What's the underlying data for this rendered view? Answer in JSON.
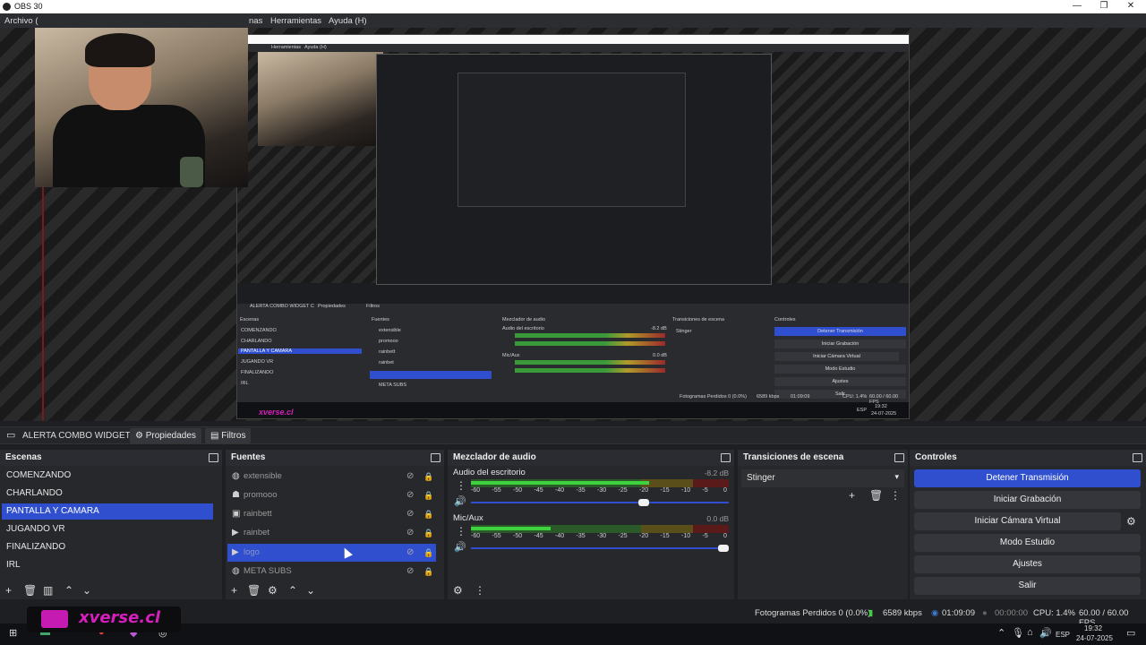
{
  "window": {
    "title": "OBS 30",
    "controls": [
      "—",
      "❐",
      "✕"
    ]
  },
  "menu": [
    "Archivo (",
    "nas",
    "Herramientas",
    "Ayuda (H)"
  ],
  "source_bar": {
    "current_source": "ALERTA COMBO WIDGET C",
    "properties": "Propiedades",
    "filters": "Filtros"
  },
  "scenes": {
    "title": "Escenas",
    "items": [
      "COMENZANDO",
      "CHARLANDO",
      "PANTALLA Y CAMARA",
      "JUGANDO VR",
      "FINALIZANDO",
      "IRL"
    ],
    "selected_index": 2
  },
  "sources": {
    "title": "Fuentes",
    "items": [
      {
        "name": "extensible",
        "icon": "globe-icon"
      },
      {
        "name": "promooo",
        "icon": "group-icon"
      },
      {
        "name": "rainbett",
        "icon": "image-icon"
      },
      {
        "name": "rainbet",
        "icon": "play-icon"
      },
      {
        "name": "logo",
        "icon": "play-icon"
      },
      {
        "name": "META SUBS",
        "icon": "globe-icon"
      }
    ],
    "selected_index": 4
  },
  "mixer": {
    "title": "Mezclador de audio",
    "channels": [
      {
        "name": "Audio del escritorio",
        "db": "-8.2 dB",
        "level": 0.69,
        "volume": 0.69
      },
      {
        "name": "Mic/Aux",
        "db": "0.0 dB",
        "level": 0.31,
        "volume": 1.0
      }
    ],
    "scale": [
      "-60",
      "-55",
      "-50",
      "-45",
      "-40",
      "-35",
      "-30",
      "-25",
      "-20",
      "-15",
      "-10",
      "-5",
      "0"
    ]
  },
  "transitions": {
    "title": "Transiciones de escena",
    "selected": "Stinger"
  },
  "controls": {
    "title": "Controles",
    "buttons": [
      "Detener Transmisión",
      "Iniciar Grabación",
      "Iniciar Cámara Virtual",
      "Modo Estudio",
      "Ajustes",
      "Salir"
    ]
  },
  "status": {
    "dropped": "Fotogramas Perdidos 0 (0.0%)",
    "bitrate": "6589 kbps",
    "stream_time": "01:09:09",
    "rec_time": "00:00:00",
    "cpu": "CPU: 1.4%",
    "fps": "60.00 / 60.00 FPS"
  },
  "taskbar": {
    "lang": "ESP",
    "time": "19:32",
    "date": "24-07-2025"
  },
  "logo_text": "xverse.cl",
  "nested": {
    "source": "ALERTA COMBO WIDGET C",
    "props": "Propiedades",
    "filters": "Filtros",
    "scenes_title": "Escenas",
    "sources_title": "Fuentes",
    "mixer_title": "Mezclador de audio",
    "transitions_title": "Transiciones de escena",
    "controls_title": "Controles",
    "desktop_audio": "Audio del escritorio",
    "mic": "Mic/Aux",
    "stinger": "Stinger",
    "menu_tools": "Herramientas",
    "menu_help": "Ayuda (H)",
    "status": "Fotogramas Perdidos 0 (0.0%)",
    "bitrate": "6589 kbps",
    "time": "01:09:09",
    "cpu": "CPU: 1.4%",
    "fps": "60.00 / 60.00 FPS",
    "lang": "ESP",
    "clock": "19:32",
    "date": "24-07-2025",
    "logo": "xverse.cl",
    "desktop_db": "-8.2 dB",
    "mic_db": "0.0 dB"
  },
  "colors": {
    "accent": "#2f4fcf",
    "panel": "#27282c",
    "brand": "#d61fbd"
  }
}
